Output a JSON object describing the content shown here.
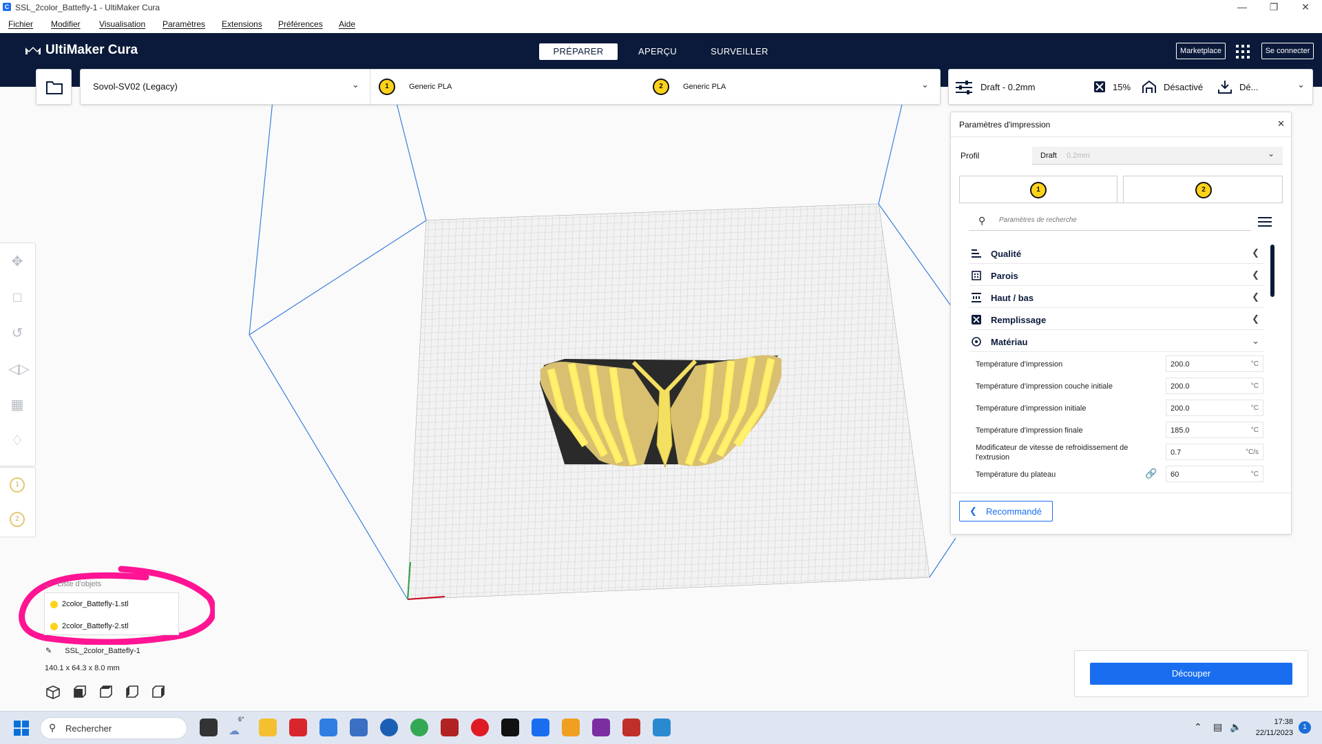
{
  "window": {
    "title": "SSL_2color_Battefly-1 - UltiMaker Cura",
    "app_icon_letter": "C"
  },
  "menu": [
    "Fichier",
    "Modifier",
    "Visualisation",
    "Paramètres",
    "Extensions",
    "Préférences",
    "Aide"
  ],
  "header": {
    "brand": "UltiMaker Cura",
    "stages": [
      "PRÉPARER",
      "APERÇU",
      "SURVEILLER"
    ],
    "active_stage": "PRÉPARER",
    "marketplace": "Marketplace",
    "login": "Se connecter"
  },
  "machine": {
    "printer": "Sovol-SV02 (Legacy)",
    "extruders": [
      {
        "index": "1",
        "material": "Generic PLA",
        "color": "#ffd21a"
      },
      {
        "index": "2",
        "material": "Generic PLA",
        "color": "#ffd21a"
      }
    ]
  },
  "print_setup": {
    "profile": "Draft - 0.2mm",
    "infill": "15%",
    "support": "Désactivé",
    "adhesion": "Dé..."
  },
  "settings_panel": {
    "title": "Paramètres d'impression",
    "profile_label": "Profil",
    "profile_name": "Draft",
    "profile_detail": "0.2mm",
    "tabs": [
      "1",
      "2"
    ],
    "search_placeholder": "Paramètres de recherche",
    "categories": [
      {
        "label": "Qualité",
        "icon": "quality-icon",
        "expanded": false
      },
      {
        "label": "Parois",
        "icon": "walls-icon",
        "expanded": false
      },
      {
        "label": "Haut / bas",
        "icon": "top-bottom-icon",
        "expanded": false
      },
      {
        "label": "Remplissage",
        "icon": "infill-icon",
        "expanded": false
      },
      {
        "label": "Matériau",
        "icon": "material-icon",
        "expanded": true
      }
    ],
    "material_settings": [
      {
        "label": "Température d'impression",
        "value": "200.0",
        "unit": "°C"
      },
      {
        "label": "Température d'impression couche initiale",
        "value": "200.0",
        "unit": "°C"
      },
      {
        "label": "Température d'impression initiale",
        "value": "200.0",
        "unit": "°C"
      },
      {
        "label": "Température d'impression finale",
        "value": "185.0",
        "unit": "°C"
      },
      {
        "label": "Modificateur de vitesse de refroidissement de l'extrusion",
        "value": "0.7",
        "unit": "°C/s"
      },
      {
        "label": "Température du plateau",
        "value": "60",
        "unit": "°C"
      }
    ],
    "recommended_button": "Recommandé"
  },
  "objects": {
    "header": "Liste d'objets",
    "items": [
      "2color_Battefly-1.stl",
      "2color_Battefly-2.stl"
    ],
    "project_name": "SSL_2color_Battefly-1",
    "dimensions": "140.1 x 64.3 x 8.0 mm"
  },
  "slice": {
    "button": "Découper"
  },
  "taskbar": {
    "search": "Rechercher",
    "weather": "6°",
    "time": "17:38",
    "date": "22/11/2023",
    "notifications": "1"
  },
  "colors": {
    "header_bg": "#0b1a3a",
    "accent": "#196ef0",
    "extruder_yellow": "#ffd21a",
    "annotation_pink": "#ff1493"
  }
}
